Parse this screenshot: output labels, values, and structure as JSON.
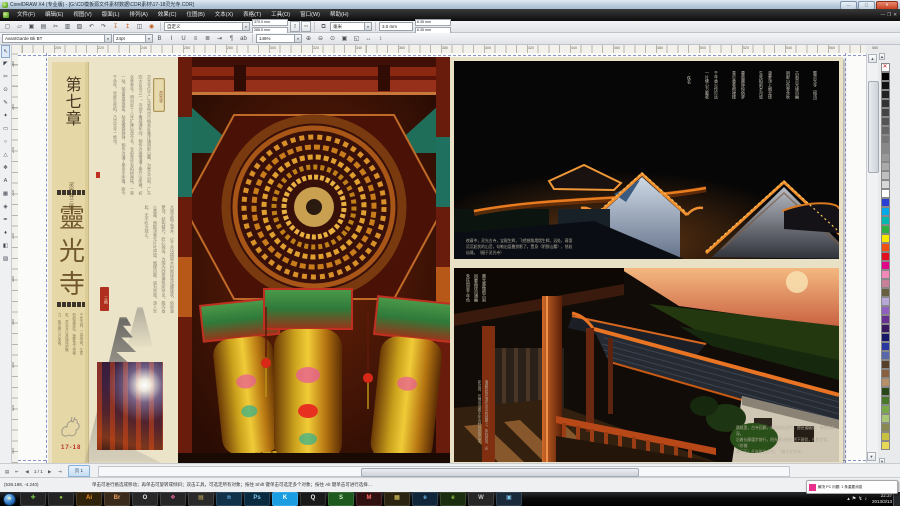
{
  "window": {
    "title": "CorelDRAW X4 (专业版) - [G:\\CD模板源文件素材数据\\CDR素材\\17-18灵光寺.CDR]",
    "min_label": "—",
    "max_label": "▢",
    "close_label": "✕"
  },
  "menu": {
    "items": [
      "文件(F)",
      "编辑(E)",
      "视图(V)",
      "版面(L)",
      "排列(A)",
      "效果(C)",
      "位图(B)",
      "文本(X)",
      "表格(T)",
      "工具(O)",
      "窗口(W)",
      "帮助(H)"
    ],
    "doc_controls": [
      "—",
      "❐",
      "✕"
    ]
  },
  "std_toolbar": {
    "icons": [
      {
        "name": "new-icon",
        "glyph": "▢"
      },
      {
        "name": "open-icon",
        "glyph": "▱"
      },
      {
        "name": "save-icon",
        "glyph": "▣"
      },
      {
        "name": "print-icon",
        "glyph": "▤"
      },
      {
        "name": "cut-icon",
        "glyph": "✂"
      },
      {
        "name": "copy-icon",
        "glyph": "▥"
      },
      {
        "name": "paste-icon",
        "glyph": "▧"
      },
      {
        "name": "undo-icon",
        "glyph": "↶"
      },
      {
        "name": "redo-icon",
        "glyph": "↷"
      },
      {
        "name": "import-icon",
        "glyph": "↧"
      },
      {
        "name": "export-icon",
        "glyph": "↥"
      },
      {
        "name": "app-launcher-icon",
        "glyph": "◫"
      },
      {
        "name": "corel-online-icon",
        "glyph": "◉"
      }
    ],
    "preset": "自定义",
    "paper_w": "370.0 mm",
    "paper_h": "285.5 mm",
    "portrait_glyph": "▯",
    "landscape_glyph": "▭",
    "units": "毫米",
    "nudge": "3.0 mm",
    "dup1": "6.35 mm",
    "dup2": "6.35 mm"
  },
  "text_bar": {
    "font": "AvantGarde Bk BT",
    "size": "24pt",
    "style_icons": [
      {
        "name": "bold-button",
        "glyph": "B"
      },
      {
        "name": "italic-button",
        "glyph": "I"
      },
      {
        "name": "underline-button",
        "glyph": "U"
      },
      {
        "name": "align-icon",
        "glyph": "≡"
      },
      {
        "name": "bullet-list-icon",
        "glyph": "≣"
      },
      {
        "name": "indent-icon",
        "glyph": "⇥"
      },
      {
        "name": "drop-cap-icon",
        "glyph": "¶"
      },
      {
        "name": "edit-text-icon",
        "glyph": "ab"
      }
    ],
    "zoom": "146%",
    "zoom_icons": [
      {
        "name": "zoom-in-icon",
        "glyph": "⊕"
      },
      {
        "name": "zoom-out-icon",
        "glyph": "⊖"
      },
      {
        "name": "zoom-selected-icon",
        "glyph": "⊙"
      },
      {
        "name": "zoom-all-icon",
        "glyph": "▣"
      },
      {
        "name": "zoom-page-icon",
        "glyph": "◱"
      },
      {
        "name": "zoom-width-icon",
        "glyph": "↔"
      },
      {
        "name": "zoom-height-icon",
        "glyph": "↕"
      }
    ]
  },
  "toolbox": [
    {
      "name": "pick-tool",
      "glyph": "↖"
    },
    {
      "name": "shape-tool",
      "glyph": "◤"
    },
    {
      "name": "crop-tool",
      "glyph": "✂"
    },
    {
      "name": "zoom-tool",
      "glyph": "⊙"
    },
    {
      "name": "freehand-tool",
      "glyph": "✎"
    },
    {
      "name": "smart-fill-tool",
      "glyph": "✦"
    },
    {
      "name": "rectangle-tool",
      "glyph": "▭"
    },
    {
      "name": "ellipse-tool",
      "glyph": "○"
    },
    {
      "name": "polygon-tool",
      "glyph": "△"
    },
    {
      "name": "basic-shapes-tool",
      "glyph": "❖"
    },
    {
      "name": "text-tool",
      "glyph": "A"
    },
    {
      "name": "table-tool",
      "glyph": "▦"
    },
    {
      "name": "blend-tool",
      "glyph": "◈"
    },
    {
      "name": "eyedropper-tool",
      "glyph": "✒"
    },
    {
      "name": "outline-pen-tool",
      "glyph": "♦"
    },
    {
      "name": "fill-tool",
      "glyph": "◧"
    },
    {
      "name": "interactive-fill-tool",
      "glyph": "▨"
    }
  ],
  "rulers": {
    "h_labels": [
      "200",
      "220",
      "240",
      "260",
      "280",
      "300",
      "320",
      "340",
      "360",
      "380",
      "400",
      "420",
      "440",
      "460",
      "480",
      "500",
      "520",
      "540",
      "560",
      "580"
    ],
    "v_labels": [
      "280",
      "260",
      "240",
      "220",
      "200",
      "180",
      "160",
      "140",
      "120",
      "100"
    ]
  },
  "palette": {
    "colors": [
      "none",
      "#000000",
      "#111111",
      "#222222",
      "#333333",
      "#444444",
      "#555555",
      "#666666",
      "#777777",
      "#888888",
      "#999999",
      "#aaaaaa",
      "#c0c0c0",
      "#d8d8d8",
      "#ffffff",
      "#2a3fd4",
      "#00a8e8",
      "#00b8b0",
      "#30b040",
      "#f8e800",
      "#f05010",
      "#e01020",
      "#e00888",
      "#f088b8",
      "#c88098",
      "#686040",
      "#b8a8d8",
      "#9060c0",
      "#683090",
      "#381860",
      "#181868",
      "#2838a0",
      "#5868a8",
      "#584028",
      "#886040",
      "#b89068",
      "#284818",
      "#487828",
      "#78a848",
      "#a8c878",
      "#888850",
      "#c8c040",
      "#e8d858"
    ]
  },
  "doc": {
    "left": {
      "chapter": "第七章",
      "subtitle": "灵光寺三绝",
      "calligraphy": [
        "靈",
        "光",
        "寺"
      ],
      "sidebar_note": "千年古刹，三绝传奇。生死柏前观荣枯，菠萝顶下悟禅机，灵光寺以其独特的魅力，吸引着八方来客。",
      "page_no": "17-18",
      "badge": "灵光寺",
      "body1": "灵光寺位于广东省梅州市梅县区雁洋镇阴那山麓，为粤东古刹，广东四大名寺之一。寺创于唐咸通年间，相传为高僧潘了拳开山所建，初名圣寿寺，明洪武十八年扩建后改今名。寺前草坪有柏树两株，一荣一枯，荣者青翠挺拔，枯者傲骨铮铮，相传为潘了拳亲手所植，距今千余年，世称生死柏，乃灵光寺一绝也。",
      "red_tag": "三绝",
      "body2": "大雄宝殿之藻井，以千余块精制木料嵌接垒成螺旋状，俗称菠萝顶，结构精巧，匠心独运，为国内同类建筑所罕见。殿内香火鼎盛，然殿顶竟无片叶停留，烟缕自散，诚为奇观。游人至此，无不叹为观止。"
    },
    "right": {
      "poem": "题灵光寺（组诗）\n\n古刹灵光境自幽\n阴那山色翠含秋\n\n菠萝顶上烟云绕\n生死柏前岁月悠\n\n暮鼓晨钟惊俗梦\n青灯黄卷照禅楼\n\n千年香火传灯远\n一片佛心万壑收\n\n·佚名",
      "captionA": "夜幕中，灵光古寺，宝殿生辉，飞檐翘角熠熠生辉。远处，暮霭\n沉沉起伏的山峦，勾勒出层叠剪影了。置身（阴那山麓），恍若\n仙境。（摄于灵光寺）",
      "side_text": "晨光熹微照古刹\n回廊曲径自通幽\n朱柱斑驳千年色\n青瓦无言岁月稠",
      "side_note": "清晨的阳光洒在古寺的回廊上，朱柱斑驳，光影交错，仿佛诉说着千年古刹的悠悠往事。",
      "captionB": "晨曦里，古寺回廊，朱柱相连而列，曲径通幽处，禅房花木深。\n沿着长廊缓步前行，阳光透过廊柱洒下斑驳，光影交错，（仿佛\n穿行于）千年时光之中。（摄于灵光寺）"
    }
  },
  "page_nav": {
    "icons_left": [
      {
        "name": "page-sorter-icon",
        "glyph": "▤"
      },
      {
        "name": "first-page-button",
        "glyph": "⇤"
      },
      {
        "name": "prev-page-button",
        "glyph": "◀"
      }
    ],
    "pos": "1 / 1",
    "icons_right": [
      {
        "name": "next-page-button",
        "glyph": "▶"
      },
      {
        "name": "last-page-button",
        "glyph": "⇥"
      }
    ],
    "tab": "页 1"
  },
  "status": {
    "coords": "(538.198, -4.240)",
    "hint": "单击可进行挑选或移动；再单击可旋转或倾斜；双击工具，可选定所有对象；按住 Shift 键单击可选定多个对象；按住 Alt 键单击可进行选择…",
    "fill_label": "✕",
    "outline_color": "#e8308a"
  },
  "balloon": {
    "text": "解决 PC 问题: 1 条重要消息",
    "accent": "#e8308a"
  },
  "taskbar": {
    "apps": [
      {
        "name": "taskbar-app-1",
        "glyph": "✚",
        "fg": "#7ac143",
        "bg": "#232323"
      },
      {
        "name": "taskbar-app-2",
        "glyph": "●",
        "fg": "#8dc63f",
        "bg": "#232323"
      },
      {
        "name": "taskbar-app-3",
        "glyph": "Ai",
        "fg": "#f7941d",
        "bg": "#31230b"
      },
      {
        "name": "taskbar-app-4",
        "glyph": "Br",
        "fg": "#e8a060",
        "bg": "#3a2a1a"
      },
      {
        "name": "taskbar-app-5",
        "glyph": "O",
        "fg": "#e8e8e8",
        "bg": "#282828"
      },
      {
        "name": "taskbar-app-6",
        "glyph": "❖",
        "fg": "#e86ca0",
        "bg": "#262626"
      },
      {
        "name": "taskbar-app-7",
        "glyph": "▤",
        "fg": "#c8b060",
        "bg": "#2a2a2a"
      },
      {
        "name": "taskbar-app-8",
        "glyph": "n",
        "fg": "#6cb8e8",
        "bg": "#12324a"
      },
      {
        "name": "taskbar-app-9",
        "glyph": "Ps",
        "fg": "#7cc4e8",
        "bg": "#0a2a3f"
      },
      {
        "name": "taskbar-app-10",
        "glyph": "K",
        "fg": "#ffffff",
        "bg": "#1b9de2"
      },
      {
        "name": "taskbar-app-11",
        "glyph": "Q",
        "fg": "#f0f0f0",
        "bg": "#1a1a1a"
      },
      {
        "name": "taskbar-app-12",
        "glyph": "S",
        "fg": "#c8e8c8",
        "bg": "#1e5a1e"
      },
      {
        "name": "taskbar-app-13",
        "glyph": "M",
        "fg": "#ff6a6a",
        "bg": "#301010"
      },
      {
        "name": "taskbar-app-14",
        "glyph": "▦",
        "fg": "#e8d060",
        "bg": "#2a2410"
      },
      {
        "name": "taskbar-app-15",
        "glyph": "e",
        "fg": "#6cb8f0",
        "bg": "#10253a"
      },
      {
        "name": "taskbar-app-16",
        "glyph": "e",
        "fg": "#8dc63f",
        "bg": "#1c2e10"
      },
      {
        "name": "taskbar-app-17",
        "glyph": "W",
        "fg": "#c0c0c0",
        "bg": "#262626"
      },
      {
        "name": "taskbar-app-18",
        "glyph": "▣",
        "fg": "#7cc4e8",
        "bg": "#1a2a3a"
      }
    ],
    "tray_icons": [
      {
        "name": "hidden-icons-button",
        "glyph": "▴"
      },
      {
        "name": "action-center-icon",
        "glyph": "⚑"
      },
      {
        "name": "network-icon",
        "glyph": "↯"
      },
      {
        "name": "volume-icon",
        "glyph": "♪"
      }
    ],
    "time": "22:37",
    "date": "2013/3/13"
  }
}
